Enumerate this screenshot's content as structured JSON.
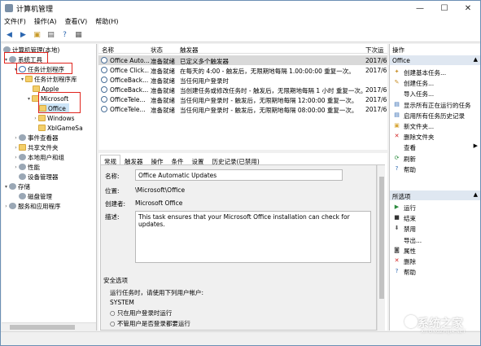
{
  "window": {
    "title": "计算机管理",
    "controls": [
      "—",
      "☐",
      "✕"
    ]
  },
  "menu": [
    "文件(F)",
    "操作(A)",
    "查看(V)",
    "帮助(H)"
  ],
  "tree": {
    "root": "计算机管理(本地)",
    "system_tools": "系统工具",
    "task_scheduler": "任务计划程序",
    "task_library": "任务计划程序库",
    "apple": "Apple",
    "microsoft": "Microsoft",
    "office": "Office",
    "windows": "Windows",
    "xbl": "XblGameSa",
    "event_viewer": "事件查看器",
    "shared_folders": "共享文件夹",
    "local_users": "本地用户和组",
    "performance": "性能",
    "device_manager": "设备管理器",
    "storage": "存储",
    "disk_management": "磁盘管理",
    "services_apps": "服务和应用程序"
  },
  "list": {
    "columns": [
      "名称",
      "状态",
      "触发器",
      "下次运"
    ],
    "rows": [
      {
        "name": "Office Auto...",
        "status": "准备就绪",
        "trigger": "已定义多个触发器",
        "next": "2017/6"
      },
      {
        "name": "Office Click...",
        "status": "准备就绪",
        "trigger": "在每天的 4:00 - 触发后，无限期地每隔 1.00:00:00 重复一次。",
        "next": "2017/6"
      },
      {
        "name": "OfficeBack...",
        "status": "准备就绪",
        "trigger": "当任何用户登录时",
        "next": ""
      },
      {
        "name": "OfficeBack...",
        "status": "准备就绪",
        "trigger": "当创建任务或修改任务时 - 触发后，无限期地每隔 1 小时 重复一次。",
        "next": "2017/6"
      },
      {
        "name": "OfficeTele...",
        "status": "准备就绪",
        "trigger": "当任何用户登录时 - 触发后，无限期地每隔 12:00:00 重复一次。",
        "next": "2017/6"
      },
      {
        "name": "OfficeTele...",
        "status": "准备就绪",
        "trigger": "当任何用户登录时 - 触发后，无限期地每隔 08:00:00 重复一次。",
        "next": "2017/6"
      }
    ]
  },
  "tabs": [
    "常规",
    "触发器",
    "操作",
    "条件",
    "设置",
    "历史记录(已禁用)"
  ],
  "detail": {
    "name_label": "名称:",
    "name_value": "Office Automatic Updates",
    "location_label": "位置:",
    "location_value": "\\Microsoft\\Office",
    "author_label": "创建者:",
    "author_value": "Microsoft Office",
    "desc_label": "描述:",
    "desc_value": "This task ensures that your Microsoft Office installation can check for updates.",
    "security_title": "安全选项",
    "run_as_label": "运行任务时，请使用下列用户帐户:",
    "run_as_value": "SYSTEM",
    "opt1": "只在用户登录时运行",
    "opt2": "不管用户是否登录都要运行"
  },
  "actions": {
    "header": "操作",
    "sec1": "Office",
    "items1": [
      "创建基本任务...",
      "创建任务...",
      "导入任务...",
      "显示所有正在运行的任务",
      "启用所有任务历史记录",
      "新文件夹...",
      "删除文件夹",
      "查看",
      "刷新",
      "帮助"
    ],
    "sec2": "所选项",
    "items2": [
      "运行",
      "结束",
      "禁用",
      "导出...",
      "属性",
      "删除",
      "帮助"
    ]
  },
  "watermark": {
    "text": "系统之家",
    "url": "XITONGZHIJIA.NET"
  }
}
